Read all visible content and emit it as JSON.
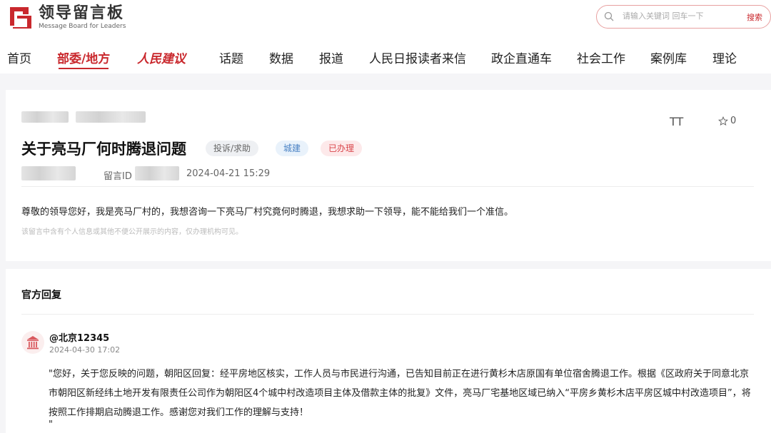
{
  "header": {
    "logo_cn": "领导留言板",
    "logo_en": "Message Board for Leaders",
    "search_placeholder": "请输入关键词 回车一下",
    "search_button": "搜索"
  },
  "nav": {
    "items": [
      {
        "label": "首页"
      },
      {
        "label": "部委/地方",
        "active": true
      },
      {
        "label": "人民建议"
      },
      {
        "label": "话题"
      },
      {
        "label": "数据"
      },
      {
        "label": "报道"
      },
      {
        "label": "人民日报读者来信"
      },
      {
        "label": "政企直通车"
      },
      {
        "label": "社会工作"
      },
      {
        "label": "案例库"
      },
      {
        "label": "理论"
      }
    ]
  },
  "message": {
    "title": "关于亮马厂何时腾退问题",
    "tags": [
      "投诉/求助",
      "城建",
      "已办理"
    ],
    "font_toggle": "TT",
    "star_count": "0",
    "id_label": "留言ID",
    "date": "2024-04-21 15:29",
    "body": "尊敬的领导您好，我是亮马厂村的，我想咨询一下亮马厂村究竟何时腾退，我想求助一下领导，能不能给我们一个准信。",
    "privacy_note": "该留言中含有个人信息或其他不便公开展示的内容，仅办理机构可见。"
  },
  "reply": {
    "section_title": "官方回复",
    "name": "@北京12345",
    "date": "2024-04-30 17:02",
    "body": "\"您好，关于您反映的问题，朝阳区回复：经平房地区核实，工作人员与市民进行沟通，已告知目前正在进行黄杉木店原国有单位宿舍腾退工作。根据《区政府关于同意北京市朝阳区新经纬土地开发有限责任公司作为朝阳区4个城中村改造项目主体及借款主体的批复》文件，亮马厂宅基地区域已纳入“平房乡黄杉木店平房区城中村改造项目”，将按照工作排期启动腾退工作。感谢您对我们工作的理解与支持！",
    "close_quote": "\""
  },
  "colors": {
    "brand_red": "#c9282d",
    "tag_blue": "#4a82c4"
  },
  "icons": [
    "logo-mark-icon",
    "search-icon",
    "star-icon",
    "government-building-icon"
  ]
}
